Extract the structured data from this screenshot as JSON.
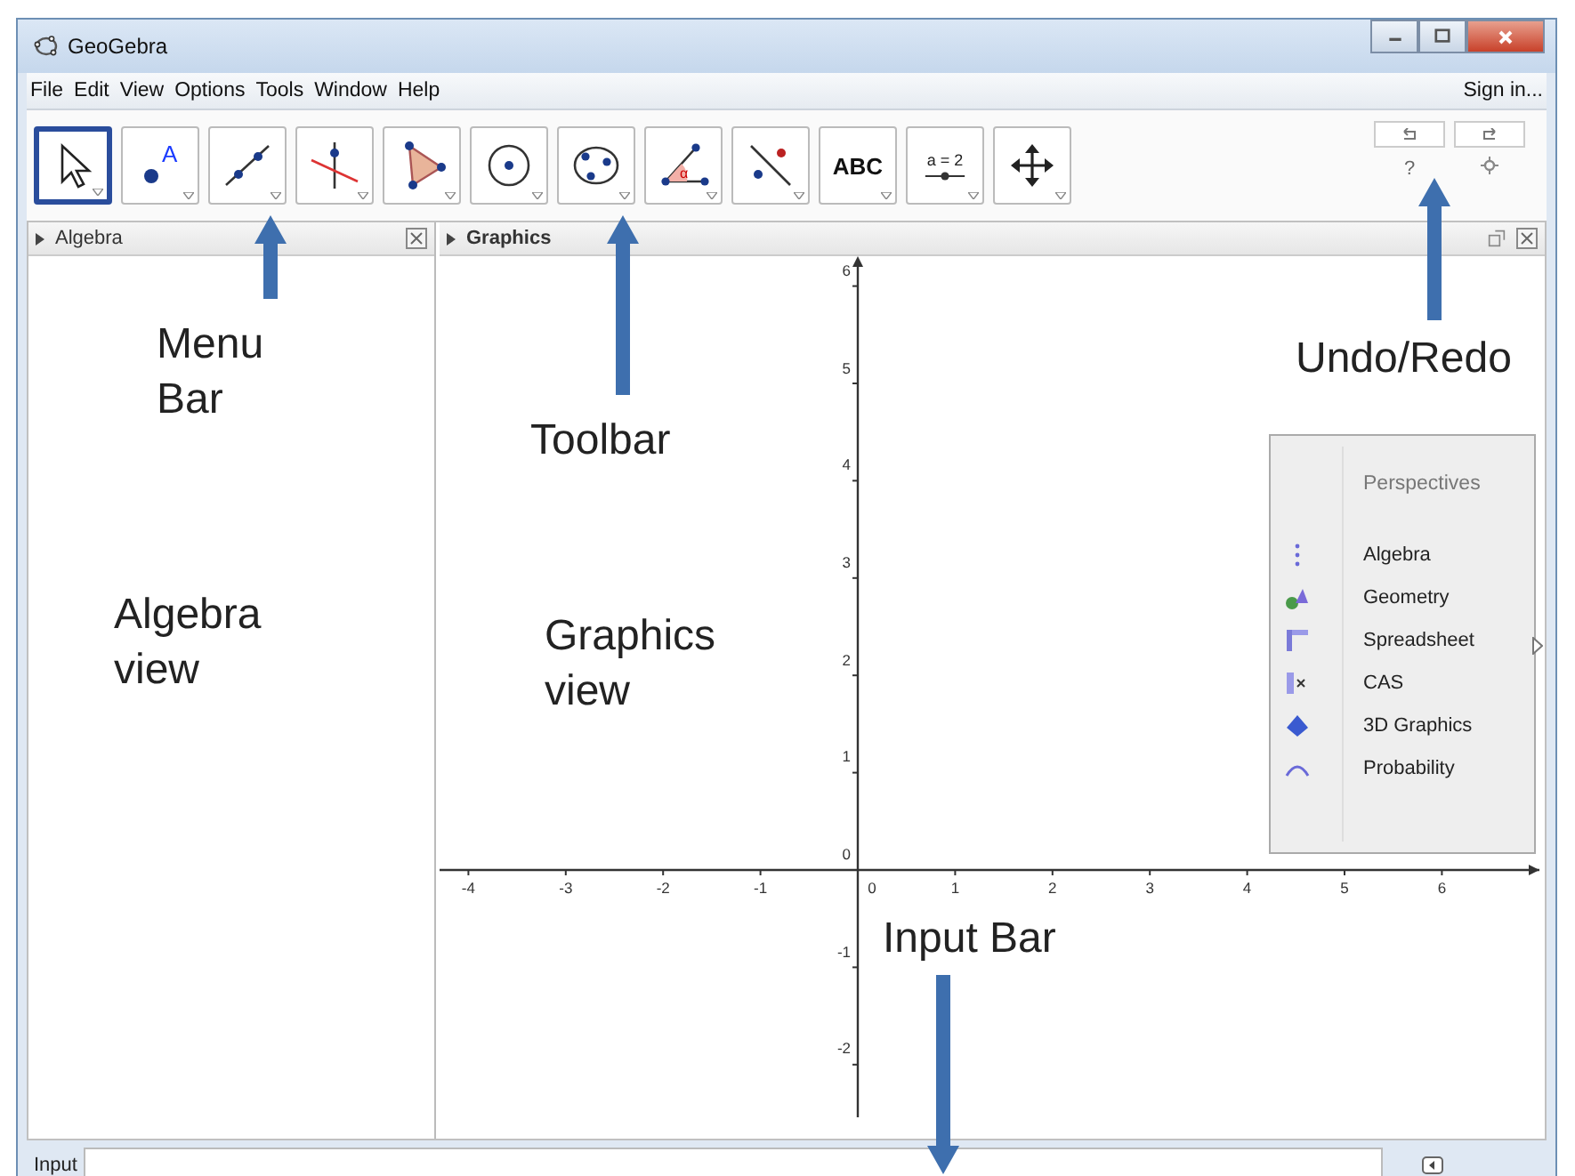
{
  "window": {
    "title": "GeoGebra"
  },
  "menu": [
    "File",
    "Edit",
    "View",
    "Options",
    "Tools",
    "Window",
    "Help"
  ],
  "sign_in": "Sign in...",
  "toolbar": [
    {
      "kind": "move",
      "selected": true
    },
    {
      "kind": "point",
      "label": "A",
      "selected": false
    },
    {
      "kind": "line",
      "selected": false
    },
    {
      "kind": "perpendicular",
      "selected": false
    },
    {
      "kind": "polygon",
      "selected": false
    },
    {
      "kind": "circle",
      "selected": false
    },
    {
      "kind": "conic",
      "selected": false
    },
    {
      "kind": "angle",
      "label": "α",
      "selected": false
    },
    {
      "kind": "reflect",
      "selected": false
    },
    {
      "kind": "text",
      "label": "ABC",
      "selected": false
    },
    {
      "kind": "slider",
      "label": "a = 2",
      "selected": false
    },
    {
      "kind": "pan",
      "selected": false
    }
  ],
  "help": "?",
  "algebra_panel": {
    "title": "Algebra"
  },
  "graphics_panel": {
    "title": "Graphics",
    "x_tick_labels": [
      "-4",
      "-3",
      "-2",
      "-1",
      "0",
      "1",
      "2",
      "3",
      "4",
      "5",
      "6"
    ],
    "y_tick_labels": [
      "6",
      "5",
      "4",
      "3",
      "2",
      "1",
      "0",
      "-1",
      "-2"
    ]
  },
  "perspectives": {
    "title": "Perspectives",
    "items": [
      {
        "kind": "algebra",
        "label": "Algebra"
      },
      {
        "kind": "geometry",
        "label": "Geometry"
      },
      {
        "kind": "spreadsheet",
        "label": "Spreadsheet"
      },
      {
        "kind": "cas",
        "label": "CAS"
      },
      {
        "kind": "solid",
        "label": "3D Graphics"
      },
      {
        "kind": "probability",
        "label": "Probability"
      }
    ]
  },
  "input_bar": {
    "label": "Input"
  },
  "annotations": [
    {
      "text": "Menu Bar",
      "kind": "menu"
    },
    {
      "text": "Toolbar",
      "kind": "toolbar"
    },
    {
      "text": "Undo/Redo",
      "kind": "undo"
    },
    {
      "text": "Algebra view",
      "kind": "algebra"
    },
    {
      "text": "Graphics view",
      "kind": "graphics"
    },
    {
      "text": "Input Bar",
      "kind": "input"
    }
  ]
}
